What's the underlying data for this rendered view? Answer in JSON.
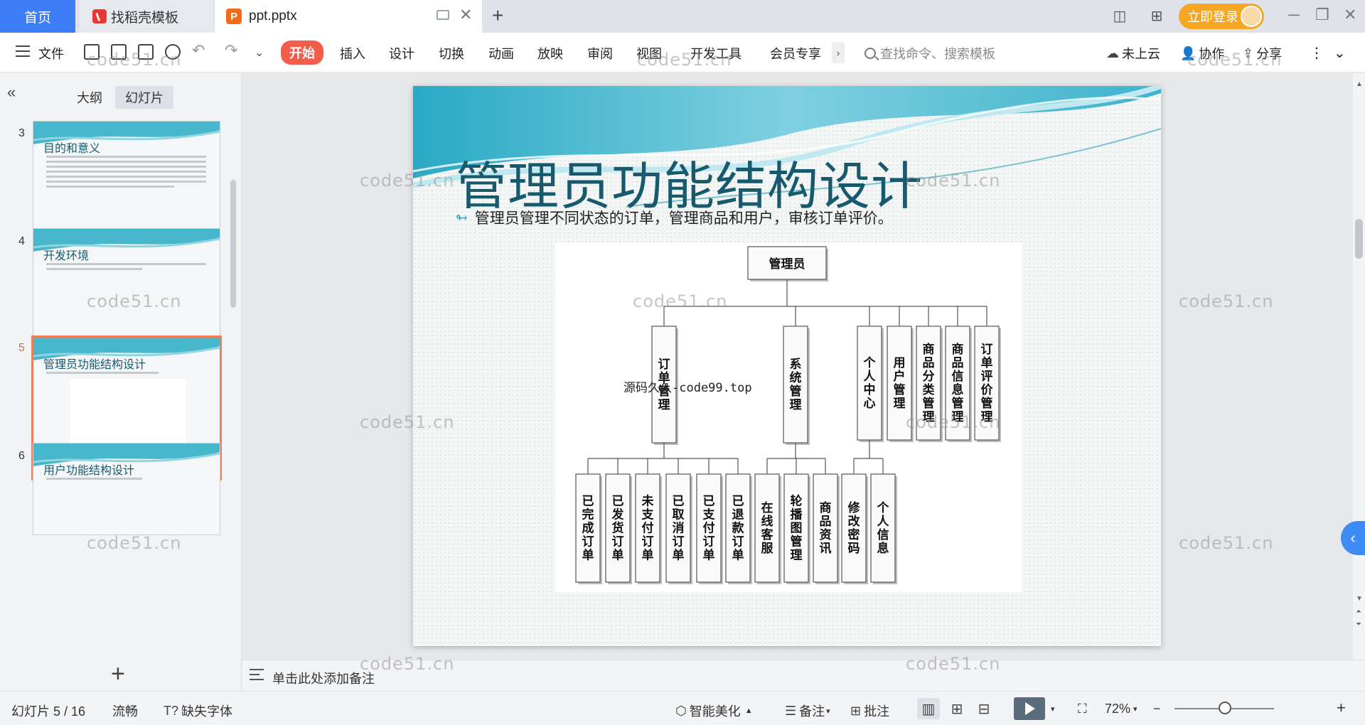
{
  "tabs": {
    "home": "首页",
    "template": "找稻壳模板",
    "file": "ppt.pptx"
  },
  "header": {
    "login": "立即登录"
  },
  "ribbon": {
    "file": "文件",
    "tabs": [
      "开始",
      "插入",
      "设计",
      "切换",
      "动画",
      "放映",
      "审阅",
      "视图",
      "开发工具",
      "会员专享"
    ],
    "search_placeholder": "查找命令、搜索模板",
    "cloud": "未上云",
    "collab": "协作",
    "share": "分享"
  },
  "leftpanel": {
    "tab_outline": "大纲",
    "tab_slides": "幻灯片",
    "slides": [
      {
        "num": "3",
        "title": "目的和意义"
      },
      {
        "num": "4",
        "title": "开发环境"
      },
      {
        "num": "5",
        "title": "管理员功能结构设计"
      },
      {
        "num": "6",
        "title": "用户功能结构设计"
      }
    ]
  },
  "slide": {
    "title": "管理员功能结构设计",
    "subtitle": "管理员管理不同状态的订单，管理商品和用户，审核订单评价。",
    "overlay": "源码久久-code99.top",
    "diagram": {
      "root": "管理员",
      "level1": [
        {
          "label": "订单管理"
        },
        {
          "label": "系统管理"
        },
        {
          "label": "个人中心"
        },
        {
          "label": "用户管理"
        },
        {
          "label": "商品分类管理"
        },
        {
          "label": "商品信息管理"
        },
        {
          "label": "订单评价管理"
        }
      ],
      "level2": [
        {
          "label": "已完成订单",
          "parent": 0
        },
        {
          "label": "已发货订单",
          "parent": 0
        },
        {
          "label": "未支付订单",
          "parent": 0
        },
        {
          "label": "已取消订单",
          "parent": 0
        },
        {
          "label": "已支付订单",
          "parent": 0
        },
        {
          "label": "已退款订单",
          "parent": 0
        },
        {
          "label": "在线客服",
          "parent": 1
        },
        {
          "label": "轮播图管理",
          "parent": 1
        },
        {
          "label": "商品资讯",
          "parent": 1
        },
        {
          "label": "修改密码",
          "parent": 2
        },
        {
          "label": "个人信息",
          "parent": 2
        }
      ]
    }
  },
  "watermark": "code51.cn",
  "notes": {
    "placeholder": "单击此处添加备注"
  },
  "statusbar": {
    "slide_count": "幻灯片 5 / 16",
    "theme": "流畅",
    "missing_font": "缺失字体",
    "beautify": "智能美化",
    "notes": "备注",
    "comments": "批注",
    "zoom": "72%"
  }
}
